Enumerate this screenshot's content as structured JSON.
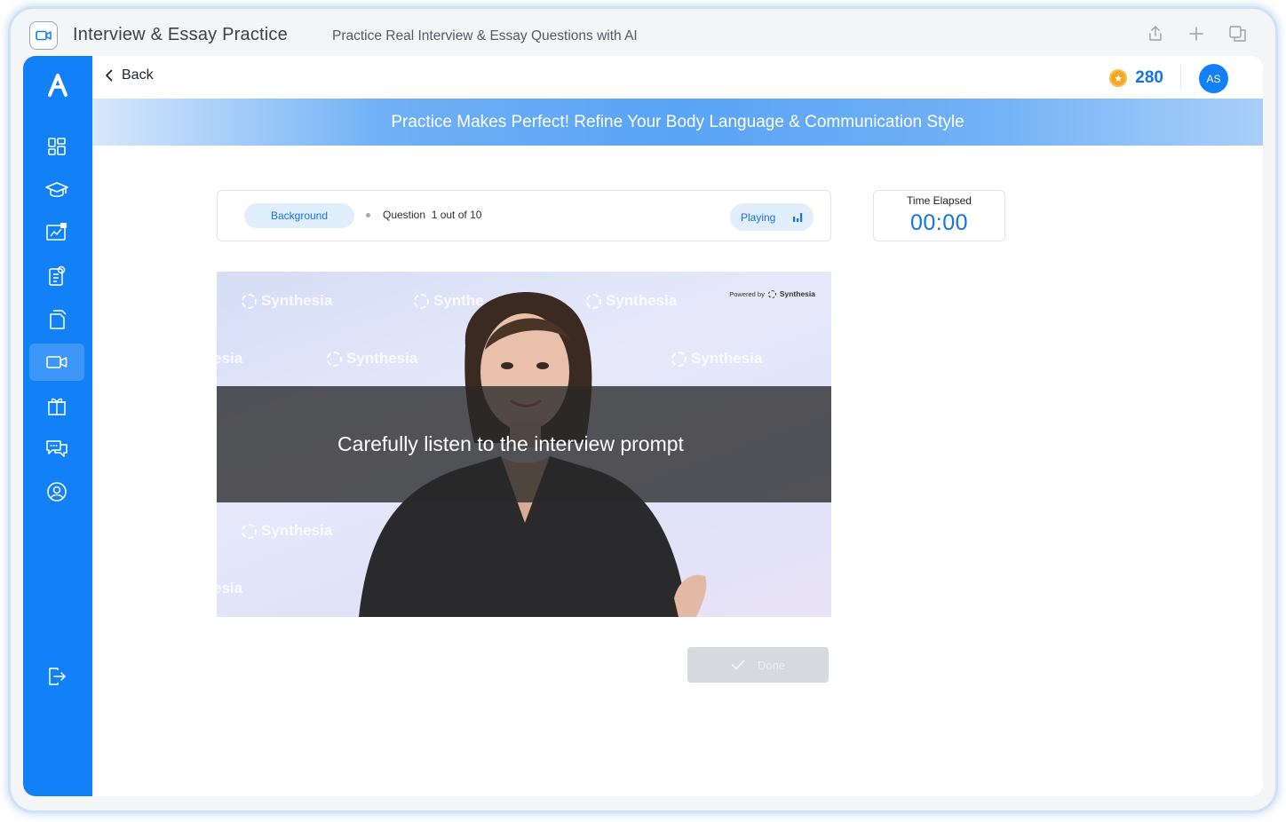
{
  "titlebar": {
    "app_title": "Interview & Essay Practice",
    "app_subtitle": "Practice Real Interview & Essay Questions with AI"
  },
  "topbar": {
    "back_label": "Back",
    "points": "280",
    "avatar_initials": "AS"
  },
  "banner": {
    "text": "Practice Makes Perfect! Refine Your Body Language & Communication Style"
  },
  "question_card": {
    "tab_label": "Background",
    "question_prefix": "Question",
    "question_progress": "1 out of 10",
    "status_label": "Playing"
  },
  "timer": {
    "label": "Time Elapsed",
    "value": "00:00"
  },
  "video": {
    "watermark": "Synthesia",
    "watermark_partial": "esia",
    "watermark_trunc": "Synthe",
    "powered_by_label": "Powered by",
    "powered_by_brand": "Synthesia",
    "overlay_text": "Carefully listen to the interview prompt"
  },
  "actions": {
    "done_label": "Done"
  },
  "colors": {
    "sidebar": "#1280f7",
    "accent": "#1473e6",
    "coin": "#f5a623"
  }
}
